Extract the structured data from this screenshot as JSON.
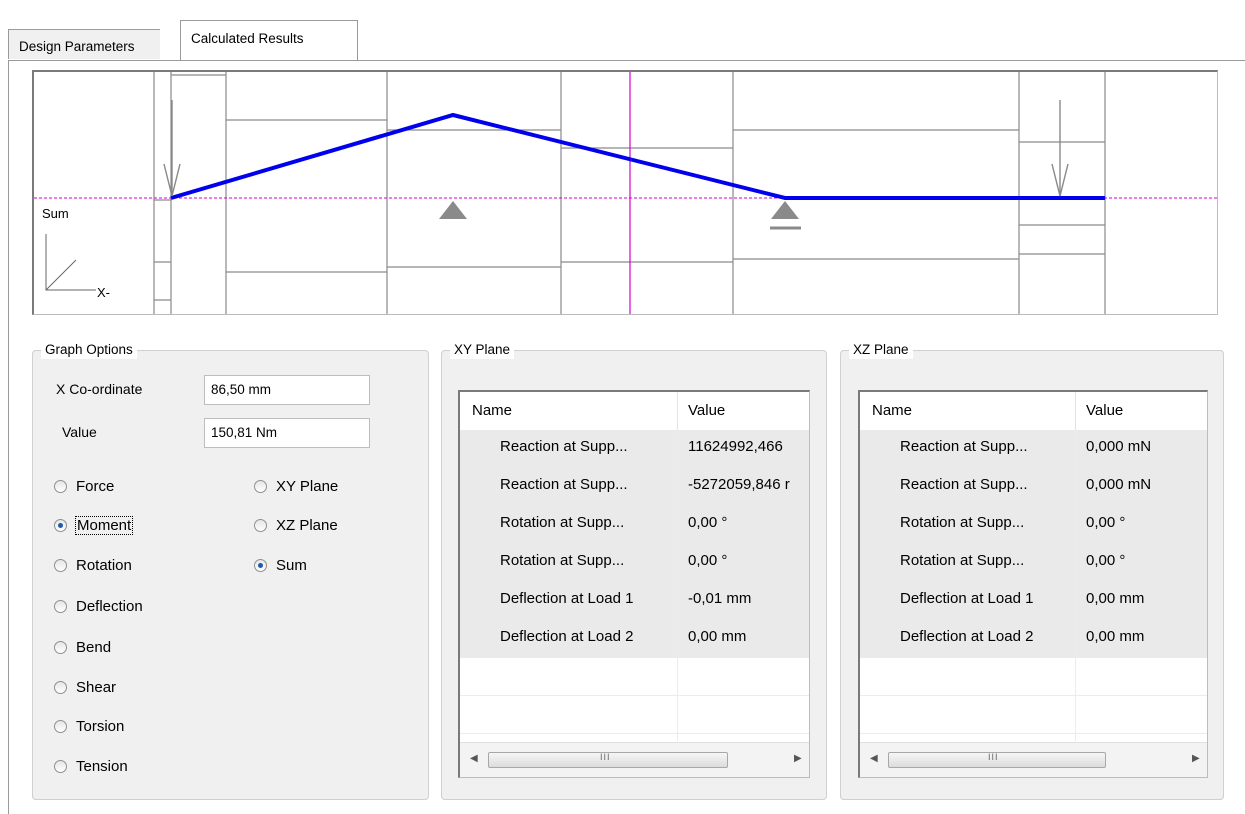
{
  "tabs": [
    {
      "label": "Design Parameters"
    },
    {
      "label": "Calculated Results"
    }
  ],
  "graph": {
    "axis_label": "Sum",
    "x_axis_label": "X-",
    "line_color": "#0000ee",
    "marker_color": "#d000d0"
  },
  "graph_options": {
    "title": "Graph Options",
    "x_coordinate_label": "X Co-ordinate",
    "x_coordinate_value": "86,50 mm",
    "value_label": "Value",
    "value_value": "150,81 Nm",
    "quantities": [
      {
        "label": "Force",
        "selected": false
      },
      {
        "label": "Moment",
        "selected": true
      },
      {
        "label": "Rotation",
        "selected": false
      },
      {
        "label": "Deflection",
        "selected": false
      },
      {
        "label": "Bend",
        "selected": false
      },
      {
        "label": "Shear",
        "selected": false
      },
      {
        "label": "Torsion",
        "selected": false
      },
      {
        "label": "Tension",
        "selected": false
      }
    ],
    "planes": [
      {
        "label": "XY Plane",
        "selected": false
      },
      {
        "label": "XZ Plane",
        "selected": false
      },
      {
        "label": "Sum",
        "selected": true
      }
    ]
  },
  "xy_plane": {
    "title": "XY Plane",
    "columns": [
      "Name",
      "Value"
    ],
    "rows": [
      {
        "name": "Reaction at Supp...",
        "value": "11624992,466"
      },
      {
        "name": "Reaction at Supp...",
        "value": "-5272059,846 r"
      },
      {
        "name": "Rotation at Supp...",
        "value": "0,00 °"
      },
      {
        "name": "Rotation at Supp...",
        "value": "0,00 °"
      },
      {
        "name": "Deflection at Load 1",
        "value": "-0,01 mm"
      },
      {
        "name": "Deflection at Load 2",
        "value": "0,00 mm"
      }
    ]
  },
  "xz_plane": {
    "title": "XZ Plane",
    "columns": [
      "Name",
      "Value"
    ],
    "rows": [
      {
        "name": "Reaction at Supp...",
        "value": "0,000 mN"
      },
      {
        "name": "Reaction at Supp...",
        "value": "0,000 mN"
      },
      {
        "name": "Rotation at Supp...",
        "value": "0,00 °"
      },
      {
        "name": "Rotation at Supp...",
        "value": "0,00 °"
      },
      {
        "name": "Deflection at Load 1",
        "value": "0,00 mm"
      },
      {
        "name": "Deflection at Load 2",
        "value": "0,00 mm"
      }
    ]
  },
  "scrollbar": {
    "grip": "III",
    "left_arrow": "◀",
    "right_arrow": "▶"
  }
}
